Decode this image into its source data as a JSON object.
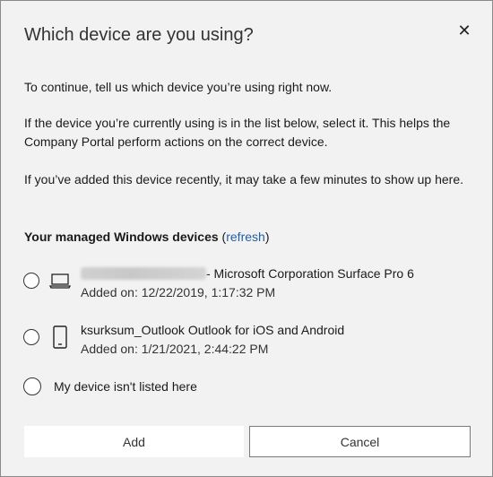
{
  "dialog": {
    "title": "Which device are you using?",
    "close_glyph": "✕",
    "intro": "To continue, tell us which device you’re using right now.",
    "help": "If the device you’re currently using is in the list below, select it. This helps the Company Portal perform actions on the correct device.",
    "recent_note": "If you’ve added this device recently, it may take a few minutes to show up here."
  },
  "devices_section": {
    "heading": "Your managed Windows devices",
    "refresh_open": " (",
    "refresh_label": "refresh",
    "refresh_close": ")"
  },
  "devices": [
    {
      "icon": "laptop-icon",
      "name_suffix": "- Microsoft Corporation Surface Pro 6",
      "added": "Added on: 12/22/2019, 1:17:32 PM"
    },
    {
      "icon": "phone-icon",
      "name": "ksurksum_Outlook Outlook for iOS and Android",
      "added": "Added on: 1/21/2021, 2:44:22 PM"
    }
  ],
  "not_listed_label": "My device isn't listed here",
  "buttons": {
    "add": "Add",
    "cancel": "Cancel"
  }
}
